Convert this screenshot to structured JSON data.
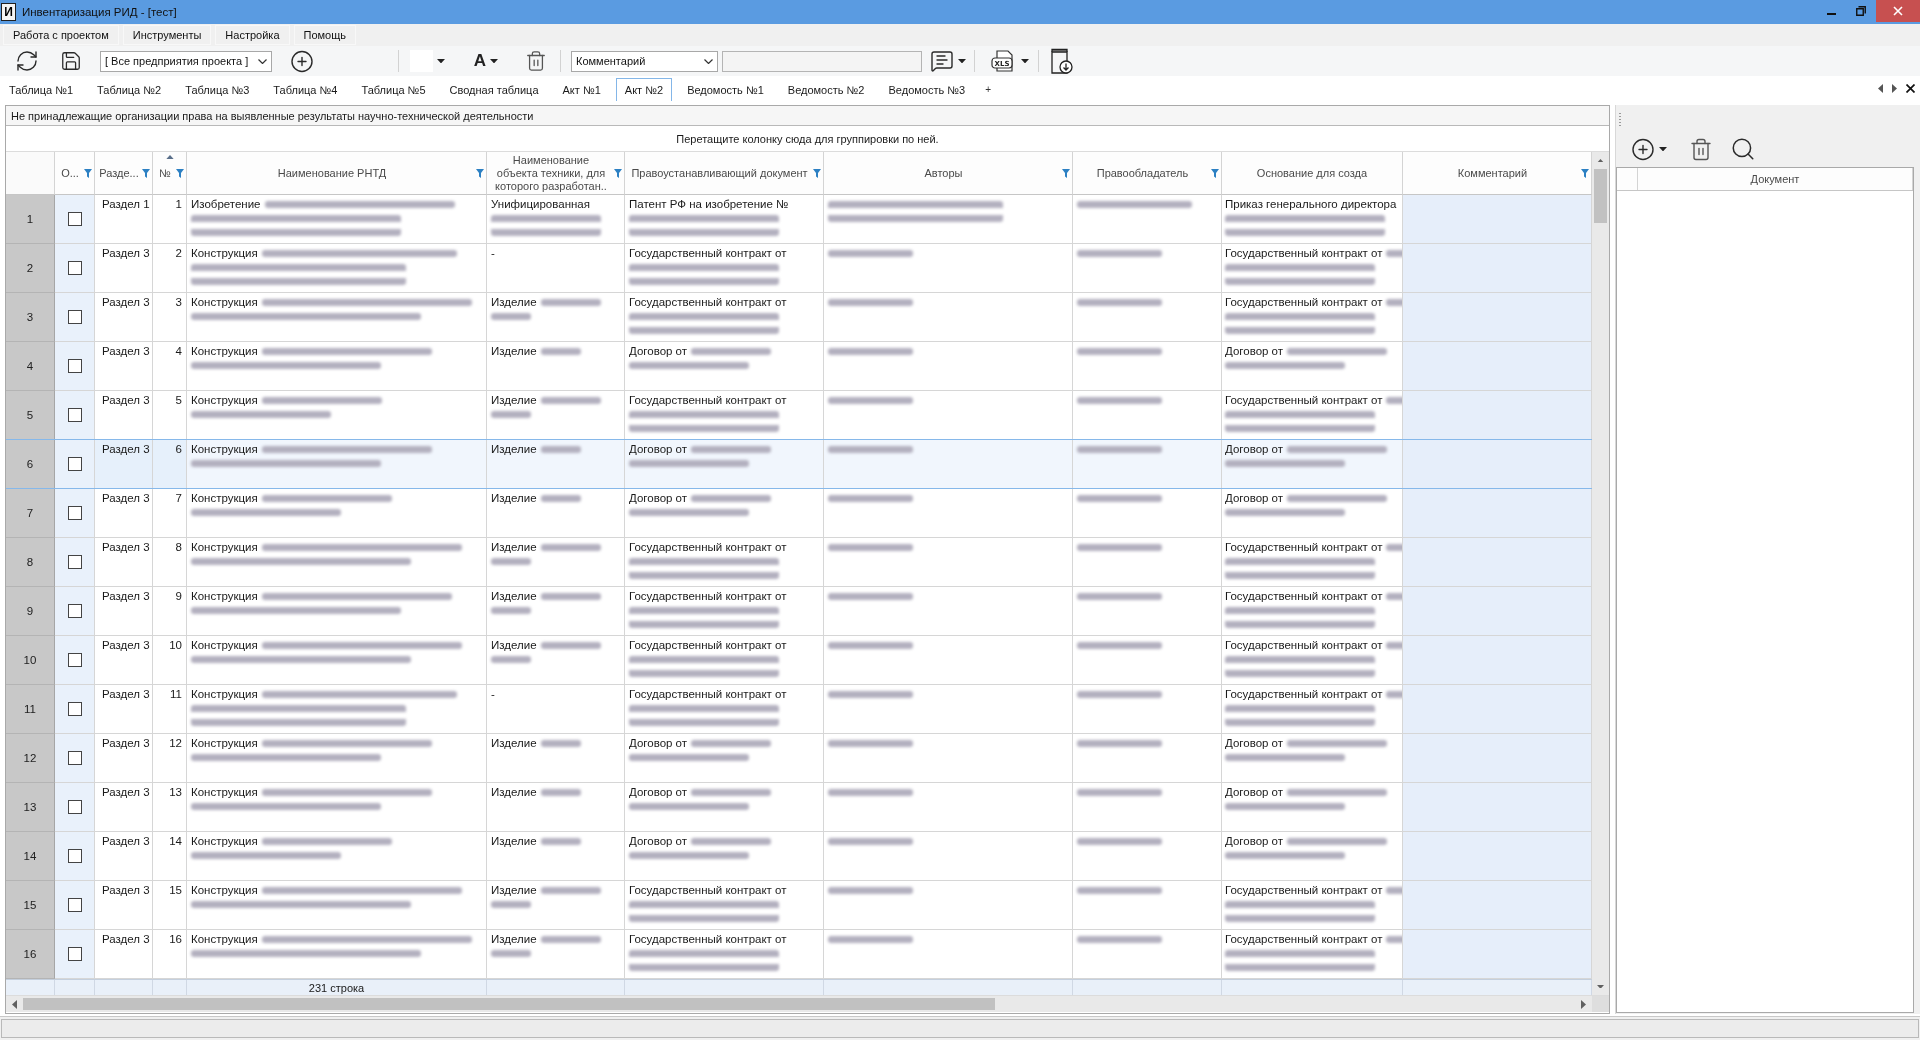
{
  "window": {
    "icon_letter": "И",
    "title": "Инвентаризация РИД - [тест]"
  },
  "menu": [
    "Работа с проектом",
    "Инструменты",
    "Настройка",
    "Помощь"
  ],
  "toolbar": {
    "enterprise_select": "[ Все предприятия проекта ]",
    "font_color_label": "A",
    "field_select": "Комментарий",
    "excel_label": "XLS"
  },
  "tabs": [
    {
      "label": "Таблица №1",
      "selected": false
    },
    {
      "label": "Таблица №2",
      "selected": false
    },
    {
      "label": "Таблица №3",
      "selected": false
    },
    {
      "label": "Таблица №4",
      "selected": false
    },
    {
      "label": "Таблица №5",
      "selected": false
    },
    {
      "label": "Сводная таблица",
      "selected": false
    },
    {
      "label": "Акт №1",
      "selected": false
    },
    {
      "label": "Акт №2",
      "selected": true
    },
    {
      "label": "Ведомость №1",
      "selected": false
    },
    {
      "label": "Ведомость №2",
      "selected": false
    },
    {
      "label": "Ведомость №3",
      "selected": false
    }
  ],
  "tab_add": "+",
  "grid": {
    "caption": "Не принадлежащие организации права на выявленные результаты научно-технической деятельности",
    "group_hint": "Перетащите колонку сюда для группировки по ней.",
    "columns": [
      {
        "label": "О...",
        "filter": true,
        "sorted": false
      },
      {
        "label": "Разде...",
        "filter": true,
        "sorted": false
      },
      {
        "label": "№",
        "filter": true,
        "sorted": true
      },
      {
        "label": "Наименование РНТД",
        "filter": true,
        "sorted": false
      },
      {
        "label": "Наименование объекта техники, для которого разработан..",
        "filter": true,
        "sorted": false
      },
      {
        "label": "Правоустанавливающий документ",
        "filter": true,
        "sorted": false
      },
      {
        "label": "Авторы",
        "filter": true,
        "sorted": false
      },
      {
        "label": "Правообладатель",
        "filter": true,
        "sorted": false
      },
      {
        "label": "Основание для созда",
        "filter": false,
        "sorted": false
      },
      {
        "label": "Комментарий",
        "filter": true,
        "sorted": false
      }
    ],
    "rows": [
      {
        "number": "1",
        "checked": false,
        "selected": false,
        "section": "Раздел 1",
        "no": "1",
        "name": "Изобретение",
        "object": "Унифицированная",
        "document": "Патент РФ на изобретение №",
        "basis": "Приказ генерального директора"
      },
      {
        "number": "2",
        "checked": false,
        "selected": false,
        "section": "Раздел 3",
        "no": "2",
        "name": "Конструкция",
        "object": "-",
        "document": "Государственный контракт от",
        "basis": "Государственный контракт от"
      },
      {
        "number": "3",
        "checked": false,
        "selected": false,
        "section": "Раздел 3",
        "no": "3",
        "name": "Конструкция",
        "object": "Изделие",
        "document": "Государственный контракт от",
        "basis": "Государственный контракт от"
      },
      {
        "number": "4",
        "checked": false,
        "selected": false,
        "section": "Раздел 3",
        "no": "4",
        "name": "Конструкция",
        "object": "Изделие",
        "document": "Договор от",
        "basis": "Договор от"
      },
      {
        "number": "5",
        "checked": false,
        "selected": false,
        "section": "Раздел 3",
        "no": "5",
        "name": "Конструкция",
        "object": "Изделие",
        "document": "Государственный контракт от",
        "basis": "Государственный контракт от"
      },
      {
        "number": "6",
        "checked": false,
        "selected": true,
        "section": "Раздел 3",
        "no": "6",
        "name": "Конструкция",
        "object": "Изделие",
        "document": "Договор от",
        "basis": "Договор от"
      },
      {
        "number": "7",
        "checked": false,
        "selected": false,
        "section": "Раздел 3",
        "no": "7",
        "name": "Конструкция",
        "object": "Изделие",
        "document": "Договор от",
        "basis": "Договор от"
      },
      {
        "number": "8",
        "checked": false,
        "selected": false,
        "section": "Раздел 3",
        "no": "8",
        "name": "Конструкция",
        "object": "Изделие",
        "document": "Государственный контракт от",
        "basis": "Государственный контракт от"
      },
      {
        "number": "9",
        "checked": false,
        "selected": false,
        "section": "Раздел 3",
        "no": "9",
        "name": "Конструкция",
        "object": "Изделие",
        "document": "Государственный контракт от",
        "basis": "Государственный контракт от"
      },
      {
        "number": "10",
        "checked": false,
        "selected": false,
        "section": "Раздел 3",
        "no": "10",
        "name": "Конструкция",
        "object": "Изделие",
        "document": "Государственный контракт от",
        "basis": "Государственный контракт от"
      },
      {
        "number": "11",
        "checked": false,
        "selected": false,
        "section": "Раздел 3",
        "no": "11",
        "name": "Конструкция",
        "object": "-",
        "document": "Государственный контракт от",
        "basis": "Государственный контракт от"
      },
      {
        "number": "12",
        "checked": false,
        "selected": false,
        "section": "Раздел 3",
        "no": "12",
        "name": "Конструкция",
        "object": "Изделие",
        "document": "Договор от",
        "basis": "Договор от"
      },
      {
        "number": "13",
        "checked": false,
        "selected": false,
        "section": "Раздел 3",
        "no": "13",
        "name": "Конструкция",
        "object": "Изделие",
        "document": "Договор от",
        "basis": "Договор от"
      },
      {
        "number": "14",
        "checked": false,
        "selected": false,
        "section": "Раздел 3",
        "no": "14",
        "name": "Конструкция",
        "object": "Изделие",
        "document": "Договор от",
        "basis": "Договор от"
      },
      {
        "number": "15",
        "checked": false,
        "selected": false,
        "section": "Раздел 3",
        "no": "15",
        "name": "Конструкция",
        "object": "Изделие",
        "document": "Государственный контракт от",
        "basis": "Государственный контракт от"
      },
      {
        "number": "16",
        "checked": false,
        "selected": false,
        "section": "Раздел 3",
        "no": "16",
        "name": "Конструкция",
        "object": "Изделие",
        "document": "Государственный контракт от",
        "basis": "Государственный контракт от"
      }
    ],
    "footer_count": "231 строка"
  },
  "document_panel": {
    "column": "Документ"
  }
}
